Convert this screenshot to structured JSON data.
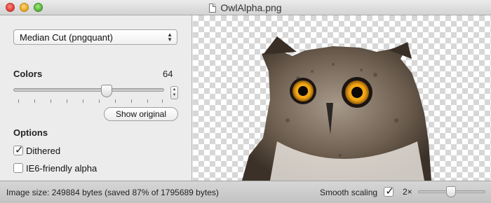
{
  "window": {
    "title": "OwlAlpha.png"
  },
  "sidebar": {
    "algorithm": "Median Cut (pngquant)",
    "colors_label": "Colors",
    "colors_value": "64",
    "colors_slider_level": 0.59,
    "show_original_label": "Show original",
    "options_label": "Options",
    "dithered_label": "Dithered",
    "dithered_checked": true,
    "ie6_label": "IE6-friendly alpha",
    "ie6_checked": false
  },
  "status": {
    "image_size": "Image size: 249884 bytes (saved 87% of 1795689 bytes)",
    "smooth_scaling_label": "Smooth scaling",
    "smooth_scaling_checked": true,
    "zoom_label": "2×",
    "zoom_slider_level": 0.55
  },
  "icons": [
    "close-button",
    "minimize-button",
    "maximize-button",
    "document-icon",
    "popup-arrows-icon",
    "stepper-icon",
    "checkbox-icon"
  ],
  "colors": {
    "window_bg": "#ececec",
    "checker": "#d7d7d7"
  }
}
